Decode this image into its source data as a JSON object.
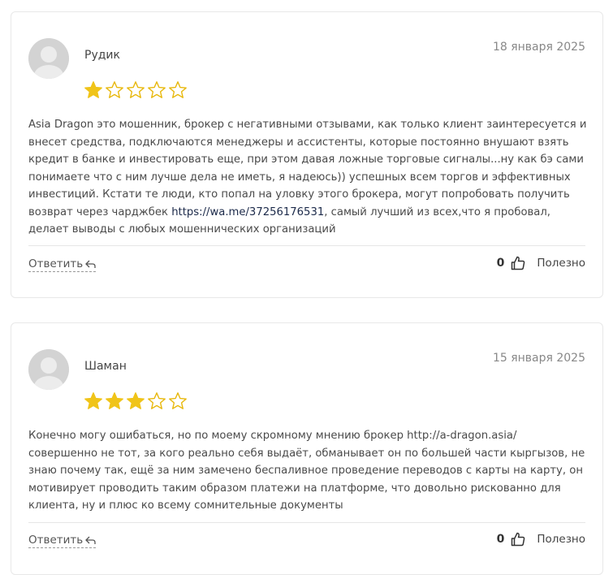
{
  "reviews": [
    {
      "author": "Рудик",
      "date": "18 января 2025",
      "rating": 1,
      "max_rating": 5,
      "body_before_link": "Asia Dragon это мошенник, брокер с негативными отзывами, как только клиент заинтересуется и внесет средства, подключаются менеджеры и ассистенты, которые постоянно внушают взять кредит в банке и инвестировать еще, при этом давая ложные торговые сигналы...ну как бэ сами понимаете что с ним лучше дела не иметь, я надеюсь)) успешных всем торгов и эффективных инвестиций. Кстати те люди, кто попал на уловку этого брокера, могут попробовать получить возврат через чарджбек ",
      "link": "https://wa.me/37256176531",
      "body_after_link": ", самый лучший из всех,что я пробовал, делает выводы с любых мошеннических организаций",
      "reply_label": "Ответить",
      "likes": "0",
      "useful_label": "Полезно"
    },
    {
      "author": "Шаман",
      "date": "15 января 2025",
      "rating": 3,
      "max_rating": 5,
      "body_before_link": "Конечно могу ошибаться, но по моему скромному мнению брокер http://a-dragon.asia/ совершенно не тот, за кого реально себя выдаёт, обманывает он по большей части кыргызов, не знаю почему так, ещё за ним замечено беспаливное проведение переводов с карты на карту, он мотивирует проводить таким образом платежи на платформе, что довольно рискованно для клиента, ну и плюс ко всему сомнительные документы",
      "link": "",
      "body_after_link": "",
      "reply_label": "Ответить",
      "likes": "0",
      "useful_label": "Полезно"
    }
  ],
  "colors": {
    "star_filled": "#f0c419",
    "star_empty_stroke": "#e8b80c",
    "link": "#1c2a4a"
  },
  "icons": {
    "avatar": "user-silhouette-icon",
    "star": "star-icon",
    "reply": "reply-arrow-icon",
    "like": "thumbs-up-icon"
  }
}
